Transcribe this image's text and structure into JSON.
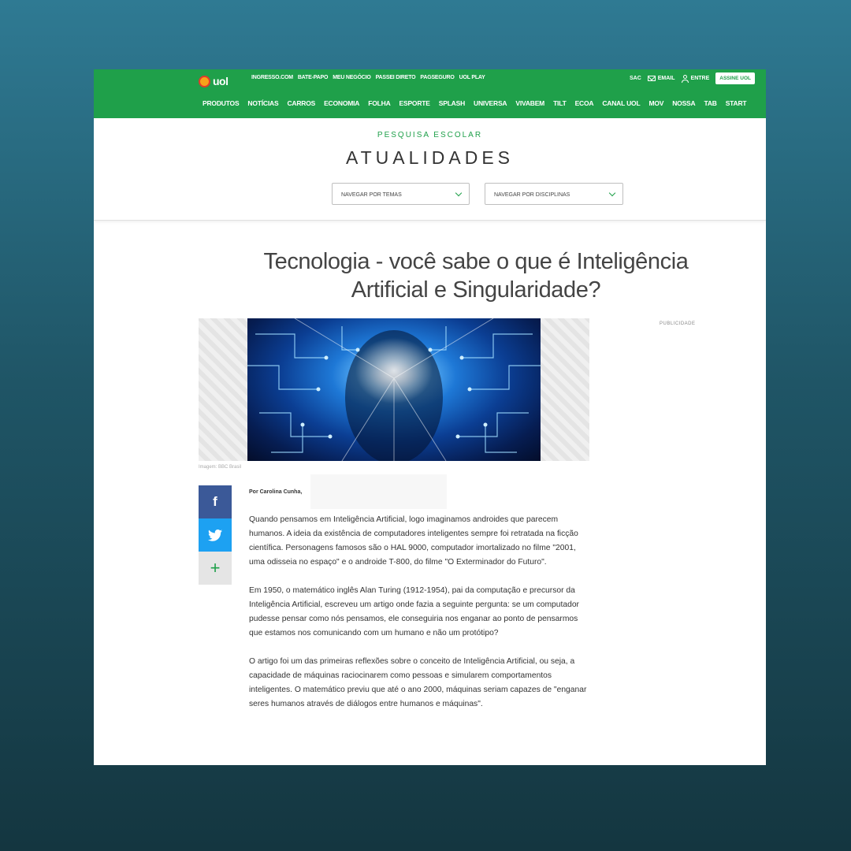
{
  "header": {
    "logo_text": "uol",
    "top_links": [
      "INGRESSO.COM",
      "BATE-PAPO",
      "MEU NEGÓCIO",
      "PASSEI DIRETO",
      "PAGSEGURO",
      "UOL PLAY"
    ],
    "sac_label": "SAC",
    "email_label": "EMAIL",
    "login_label": "ENTRE",
    "subscribe_label": "ASSINE UOL",
    "nav_items": [
      "PRODUTOS",
      "NOTÍCIAS",
      "CARROS",
      "ECONOMIA",
      "FOLHA",
      "ESPORTE",
      "SPLASH",
      "UNIVERSA",
      "VIVABEM",
      "TILT",
      "ECOA",
      "CANAL UOL",
      "MOV",
      "NOSSA",
      "TAB",
      "START"
    ]
  },
  "section": {
    "kicker": "PESQUISA ESCOLAR",
    "title": "ATUALIDADES",
    "dropdown_temas": "NAVEGAR POR TEMAS",
    "dropdown_disciplinas": "NAVEGAR POR DISCIPLINAS"
  },
  "article": {
    "title": "Tecnologia - você sabe o que é Inteligência Artificial e Singularidade?",
    "ad_label": "PUBLICIDADE",
    "image_caption": "Imagem: BBC Brasil",
    "byline": "Por Carolina Cunha,",
    "paragraphs": [
      "Quando pensamos em Inteligência Artificial, logo imaginamos androides que parecem humanos. A ideia da existência de computadores inteligentes sempre foi retratada na ficção científica. Personagens famosos são o HAL 9000, computador imortalizado no filme \"2001, uma odisseia no espaço\" e o androide T-800, do filme \"O Exterminador do Futuro\".",
      "Em 1950, o matemático inglês Alan Turing (1912-1954), pai da computação e precursor da Inteligência Artificial, escreveu um artigo onde fazia a seguinte pergunta: se um computador pudesse pensar como nós pensamos, ele conseguiria nos enganar ao ponto de pensarmos que estamos nos comunicando com um humano e não um protótipo?",
      "O artigo foi um das primeiras reflexões sobre o conceito de Inteligência Artificial, ou seja, a capacidade de máquinas raciocinarem como pessoas e simularem comportamentos inteligentes. O matemático previu que até o ano 2000, máquinas seriam capazes de \"enganar seres humanos através de diálogos entre humanos e máquinas\"."
    ]
  },
  "share": {
    "facebook_glyph": "f",
    "more_glyph": "+"
  },
  "colors": {
    "brand_green": "#1fa04a",
    "facebook": "#3b5998",
    "twitter": "#1da1f2"
  }
}
